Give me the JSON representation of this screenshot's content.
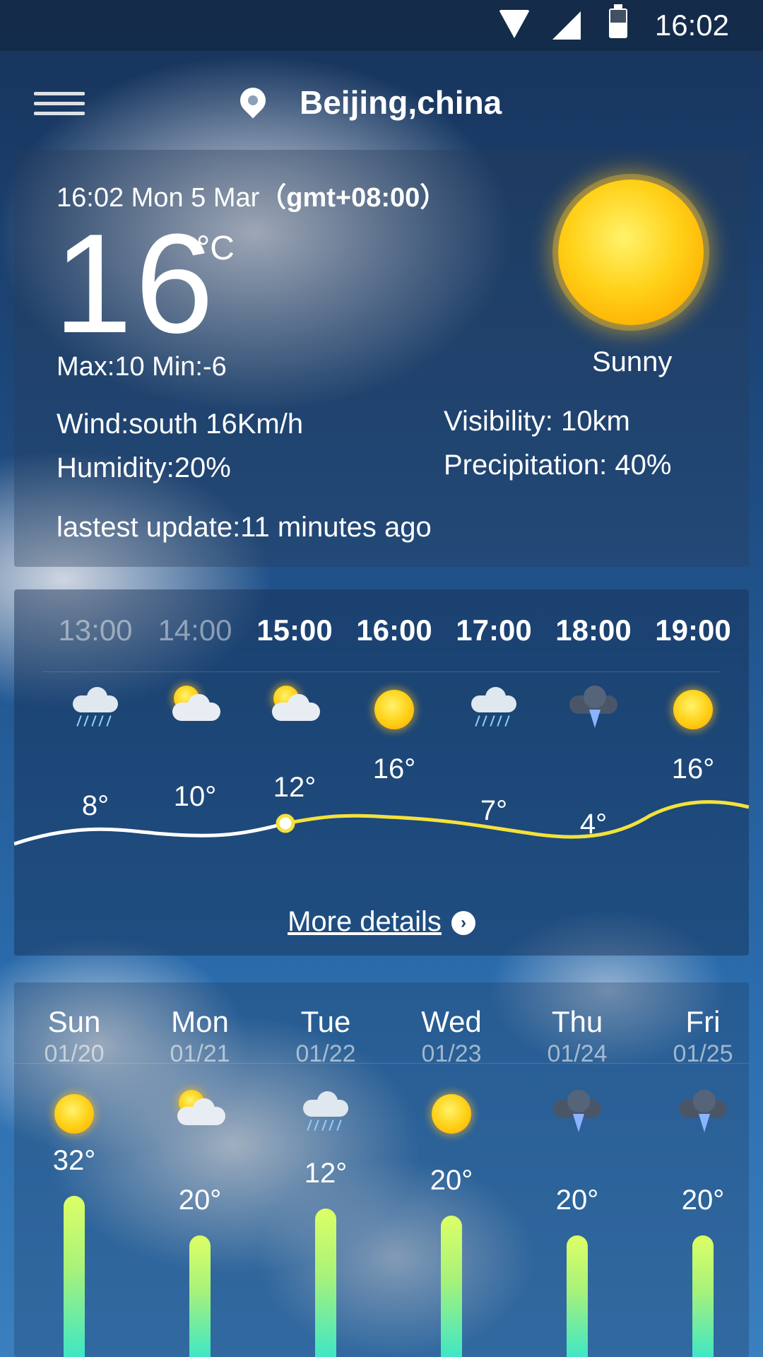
{
  "status_bar": {
    "time": "16:02",
    "icons": [
      "wifi-icon",
      "signal-icon",
      "battery-icon"
    ]
  },
  "header": {
    "location": "Beijing,china",
    "menu_icon": "menu-icon",
    "location_icon": "location-pin-icon"
  },
  "current": {
    "datetime": "16:02 Mon 5 Mar",
    "timezone": "（gmt+08:00）",
    "temperature": "16",
    "unit": "°C",
    "max_min": "Max:10  Min:-6",
    "condition": "Sunny",
    "condition_icon": "sun-icon",
    "wind": "Wind:south  16Km/h",
    "humidity": "Humidity:20%",
    "visibility": "Visibility: 10km",
    "precipitation": "Precipitation: 40%",
    "last_update": "lastest update:11 minutes ago"
  },
  "hourly": {
    "hours": [
      {
        "time": "13:00",
        "icon": "rain-cloud-icon",
        "temp": "8°",
        "past": true
      },
      {
        "time": "14:00",
        "icon": "partly-cloudy-icon",
        "temp": "10°",
        "past": true
      },
      {
        "time": "15:00",
        "icon": "partly-cloudy-icon",
        "temp": "12°",
        "past": false
      },
      {
        "time": "16:00",
        "icon": "sun-icon",
        "temp": "16°",
        "past": false
      },
      {
        "time": "17:00",
        "icon": "rain-cloud-icon",
        "temp": "7°",
        "past": false
      },
      {
        "time": "18:00",
        "icon": "thunderstorm-icon",
        "temp": "4°",
        "past": false
      },
      {
        "time": "19:00",
        "icon": "sun-icon",
        "temp": "16°",
        "past": false
      }
    ],
    "more_label": "More details"
  },
  "daily": {
    "days": [
      {
        "day": "Sun",
        "date": "01/20",
        "icon": "sun-icon",
        "temp": "32°",
        "value": 32
      },
      {
        "day": "Mon",
        "date": "01/21",
        "icon": "partly-cloudy-icon",
        "temp": "20°",
        "value": 20
      },
      {
        "day": "Tue",
        "date": "01/22",
        "icon": "rain-cloud-icon",
        "temp": "12°",
        "value": 12
      },
      {
        "day": "Wed",
        "date": "01/23",
        "icon": "sun-icon",
        "temp": "20°",
        "value": 20
      },
      {
        "day": "Thu",
        "date": "01/24",
        "icon": "thunderstorm-icon",
        "temp": "20°",
        "value": 20
      },
      {
        "day": "Fri",
        "date": "01/25",
        "icon": "thunderstorm-icon",
        "temp": "20°",
        "value": 20
      }
    ]
  },
  "colors": {
    "past_line": "#ffffff",
    "future_line": "#f4e23a",
    "bar_top": "#ddff66",
    "bar_bottom": "#3fe6c5"
  }
}
